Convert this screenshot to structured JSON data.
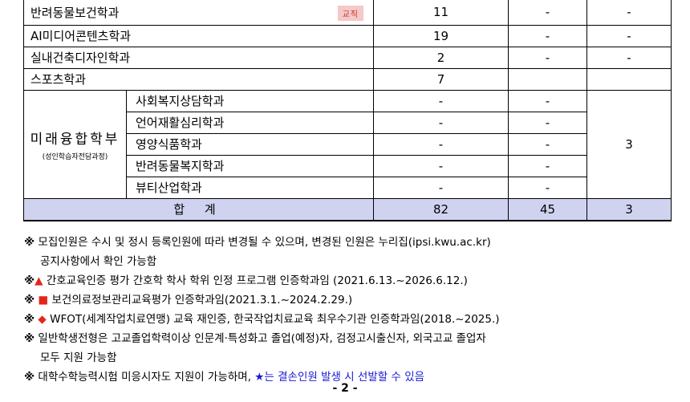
{
  "rows": [
    {
      "name": "반려동물보건학과",
      "badge": "교직",
      "c1": "11",
      "c2": "-",
      "c3": "-"
    },
    {
      "name": "AI미디어콘텐츠학과",
      "c1": "19",
      "c2": "-",
      "c3": "-"
    },
    {
      "name": "실내건축디자인학과",
      "c1": "2",
      "c2": "-",
      "c3": "-"
    },
    {
      "name": "스포츠학과",
      "c1": "7",
      "c2": "",
      "c3": ""
    }
  ],
  "division": {
    "title": "미래융합학부",
    "note": "(성인학습자전담과정)",
    "merged_value": "3",
    "subs": [
      {
        "name": "사회복지상담학과",
        "c1": "-",
        "c2": "-"
      },
      {
        "name": "언어재활심리학과",
        "c1": "-",
        "c2": "-"
      },
      {
        "name": "영양식품학과",
        "c1": "-",
        "c2": "-"
      },
      {
        "name": "반려동물복지학과",
        "c1": "-",
        "c2": "-"
      },
      {
        "name": "뷰티산업학과",
        "c1": "-",
        "c2": "-"
      }
    ]
  },
  "total": {
    "label": "합 계",
    "c1": "82",
    "c2": "45",
    "c3": "3"
  },
  "notes": {
    "n1_mark": "※",
    "n1_line1": "모집인원은 수시 및 정시 등록인원에 따라 변경될 수 있으며, 변경된 인원은 누리집(ipsi.kwu.ac.kr)",
    "n1_line2": "공지사항에서 확인 가능함",
    "n2_mark": "※",
    "n2_symbol": "▲",
    "n2_text": "간호교육인증 평가 간호학 학사 학위 인정 프로그램 인증학과임 (2021.6.13.~2026.6.12.)",
    "n3_mark": "※",
    "n3_symbol": "■",
    "n3_text": "보건의료정보관리교육평가 인증학과임(2021.3.1.~2024.2.29.)",
    "n4_mark": "※",
    "n4_symbol": "◆",
    "n4_text": "WFOT(세계작업치료연맹) 교육 재인증, 한국작업치료교육 최우수기관 인증학과임(2018.~2025.)",
    "n5_mark": "※",
    "n5_line1": "일반학생전형은 고교졸업학력이상 인문계·특성화고 졸업(예정)자, 검정고시출신자, 외국고교 졸업자",
    "n5_line2": "모두 지원 가능함",
    "n6_mark": "※",
    "n6_text": "대학수학능력시험 미응시자도 지원이 가능하며,",
    "n6_star": "★",
    "n6_blue": "는 결손인원 발생 시 선발할 수 있음"
  },
  "page_number": "- 2 -"
}
